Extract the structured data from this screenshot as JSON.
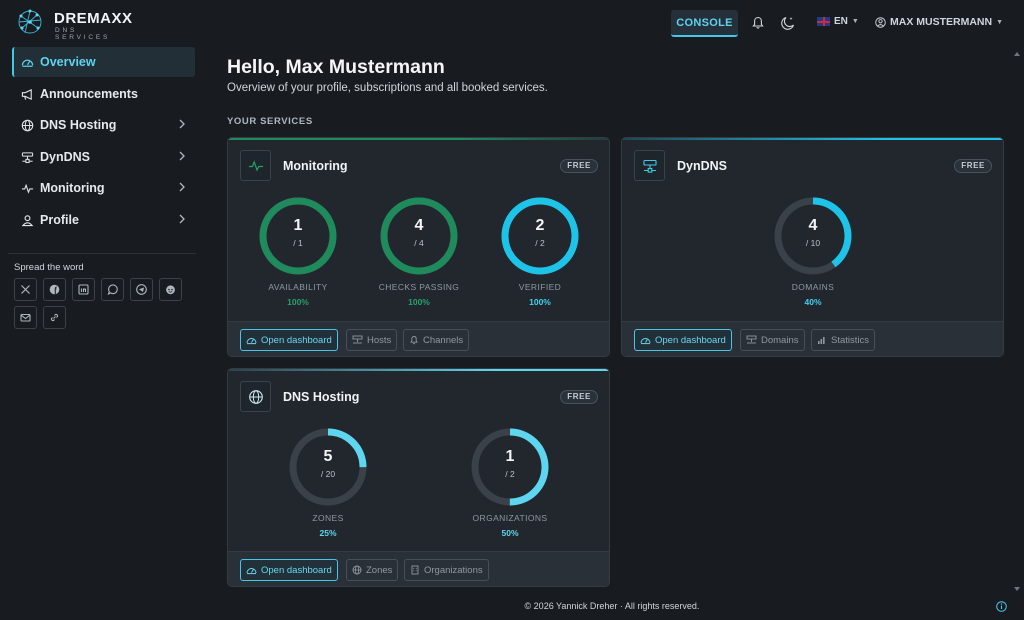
{
  "brand": {
    "name": "DREMAXX",
    "tagline": "DNS SERVICES"
  },
  "topnav": {
    "console_label": "CONSOLE",
    "language": "EN",
    "user": "MAX MUSTERMANN",
    "icons": [
      "bell-icon",
      "moon-icon",
      "uk-flag-icon",
      "user-circle-icon"
    ]
  },
  "sidebar": {
    "items": [
      {
        "label": "Overview",
        "icon": "dashboard-icon",
        "active": true
      },
      {
        "label": "Announcements",
        "icon": "megaphone-icon"
      },
      {
        "label": "DNS Hosting",
        "icon": "globe-icon"
      },
      {
        "label": "DynDNS",
        "icon": "network-icon"
      },
      {
        "label": "Monitoring",
        "icon": "pulse-icon"
      },
      {
        "label": "Profile",
        "icon": "user-icon"
      }
    ],
    "spread_label": "Spread the word",
    "share_icons": [
      "x-icon",
      "facebook-icon",
      "linkedin-icon",
      "whatsapp-icon",
      "telegram-icon",
      "reddit-icon",
      "email-icon",
      "link-icon"
    ]
  },
  "main": {
    "greeting": "Hello, Max Mustermann",
    "subtitle": "Overview of your profile, subscriptions and all booked services.",
    "section_title": "YOUR SERVICES"
  },
  "cards": {
    "monitoring": {
      "title": "Monitoring",
      "badge": "FREE",
      "accent": "#1f8a5c",
      "gauges": [
        {
          "value": "1",
          "max": "/ 1",
          "label": "AVAILABILITY",
          "pct": "100%",
          "fraction": 1.0,
          "color": "#1f8a5c"
        },
        {
          "value": "4",
          "max": "/ 4",
          "label": "CHECKS PASSING",
          "pct": "100%",
          "fraction": 1.0,
          "color": "#1f8a5c"
        },
        {
          "value": "2",
          "max": "/ 2",
          "label": "VERIFIED",
          "pct": "100%",
          "fraction": 1.0,
          "color": "#1ec4e8"
        }
      ],
      "buttons": [
        "Open dashboard",
        "Hosts",
        "Channels"
      ]
    },
    "dyndns": {
      "title": "DynDNS",
      "badge": "FREE",
      "accent": "#1ec4e8",
      "gauges": [
        {
          "value": "4",
          "max": "/ 10",
          "label": "DOMAINS",
          "pct": "40%",
          "fraction": 0.4,
          "color": "#1ec4e8"
        }
      ],
      "buttons": [
        "Open dashboard",
        "Domains",
        "Statistics"
      ]
    },
    "dnshosting": {
      "title": "DNS Hosting",
      "badge": "FREE",
      "accent": "#5fd6ef",
      "gauges": [
        {
          "value": "5",
          "max": "/ 20",
          "label": "ZONES",
          "pct": "25%",
          "fraction": 0.25,
          "color": "#5fd6ef"
        },
        {
          "value": "1",
          "max": "/ 2",
          "label": "ORGANIZATIONS",
          "pct": "50%",
          "fraction": 0.5,
          "color": "#5fd6ef"
        }
      ],
      "buttons": [
        "Open dashboard",
        "Zones",
        "Organizations"
      ]
    }
  },
  "footer": {
    "copyright": "© 2026 Yannick Dreher · All rights reserved."
  },
  "colors": {
    "accent": "#45c8e6",
    "green": "#1f8a5c",
    "background": "#181c21",
    "card": "#22272d"
  }
}
